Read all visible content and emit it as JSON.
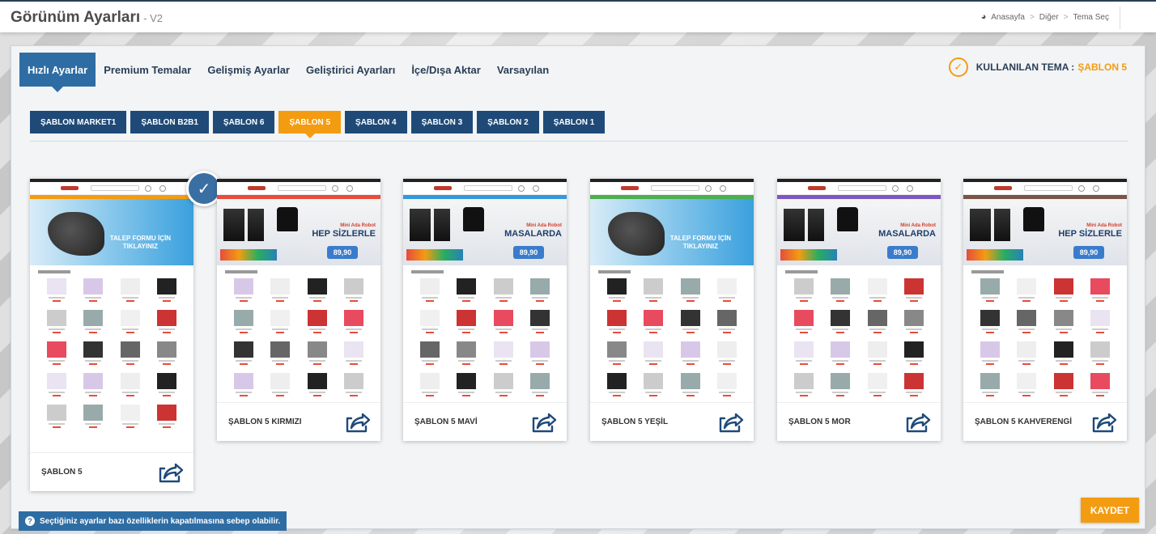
{
  "header": {
    "title": "Görünüm Ayarları",
    "version": "- V2",
    "breadcrumb": [
      "Anasayfa",
      "Diğer",
      "Tema Seç"
    ]
  },
  "tabs": [
    {
      "label": "Hızlı Ayarlar",
      "active": true
    },
    {
      "label": "Premium Temalar",
      "active": false
    },
    {
      "label": "Gelişmiş Ayarlar",
      "active": false
    },
    {
      "label": "Geliştirici Ayarları",
      "active": false
    },
    {
      "label": "İçe/Dışa Aktar",
      "active": false
    },
    {
      "label": "Varsayılan",
      "active": false
    }
  ],
  "theme_status": {
    "label": "KULLANILAN TEMA :",
    "value": "ŞABLON 5"
  },
  "templates": [
    {
      "label": "ŞABLON MARKET1",
      "active": false
    },
    {
      "label": "ŞABLON B2B1",
      "active": false
    },
    {
      "label": "ŞABLON 6",
      "active": false
    },
    {
      "label": "ŞABLON 5",
      "active": true
    },
    {
      "label": "ŞABLON 4",
      "active": false
    },
    {
      "label": "ŞABLON 3",
      "active": false
    },
    {
      "label": "ŞABLON 2",
      "active": false
    },
    {
      "label": "ŞABLON 1",
      "active": false
    }
  ],
  "variants": [
    {
      "label": "ŞABLON 5",
      "accent": "#f39c12",
      "banner": "tool",
      "selected": true
    },
    {
      "label": "ŞABLON 5 KIRMIZI",
      "accent": "#e74c3c",
      "banner": "robot",
      "selected": false
    },
    {
      "label": "ŞABLON 5 MAVİ",
      "accent": "#3498db",
      "banner": "robot",
      "selected": false
    },
    {
      "label": "ŞABLON 5 YEŞİL",
      "accent": "#4caf50",
      "banner": "tool",
      "selected": false
    },
    {
      "label": "ŞABLON 5 MOR",
      "accent": "#7e57c2",
      "banner": "robot",
      "selected": false
    },
    {
      "label": "ŞABLON 5 KAHVERENGİ",
      "accent": "#795548",
      "banner": "robot",
      "selected": false
    }
  ],
  "banners": {
    "robot": {
      "line1": "Mini Ada Robot",
      "line2": "HEP SİZLERLE",
      "price": "89,90"
    },
    "robot_alt": {
      "line1": "Mini Ada Robot",
      "line2": "MASALARDA",
      "price": "89,90"
    },
    "tool": {
      "line1": "TALEP FORMU İÇİN",
      "line2": "TIKLAYINIZ"
    }
  },
  "warning_text": "Seçtiğiniz ayarlar bazı özelliklerin kapatılmasına sebep olabilir.",
  "save_label": "KAYDET",
  "colors": {
    "primary": "#2e6da4",
    "navy": "#1f4a78",
    "accent": "#f39c12"
  }
}
